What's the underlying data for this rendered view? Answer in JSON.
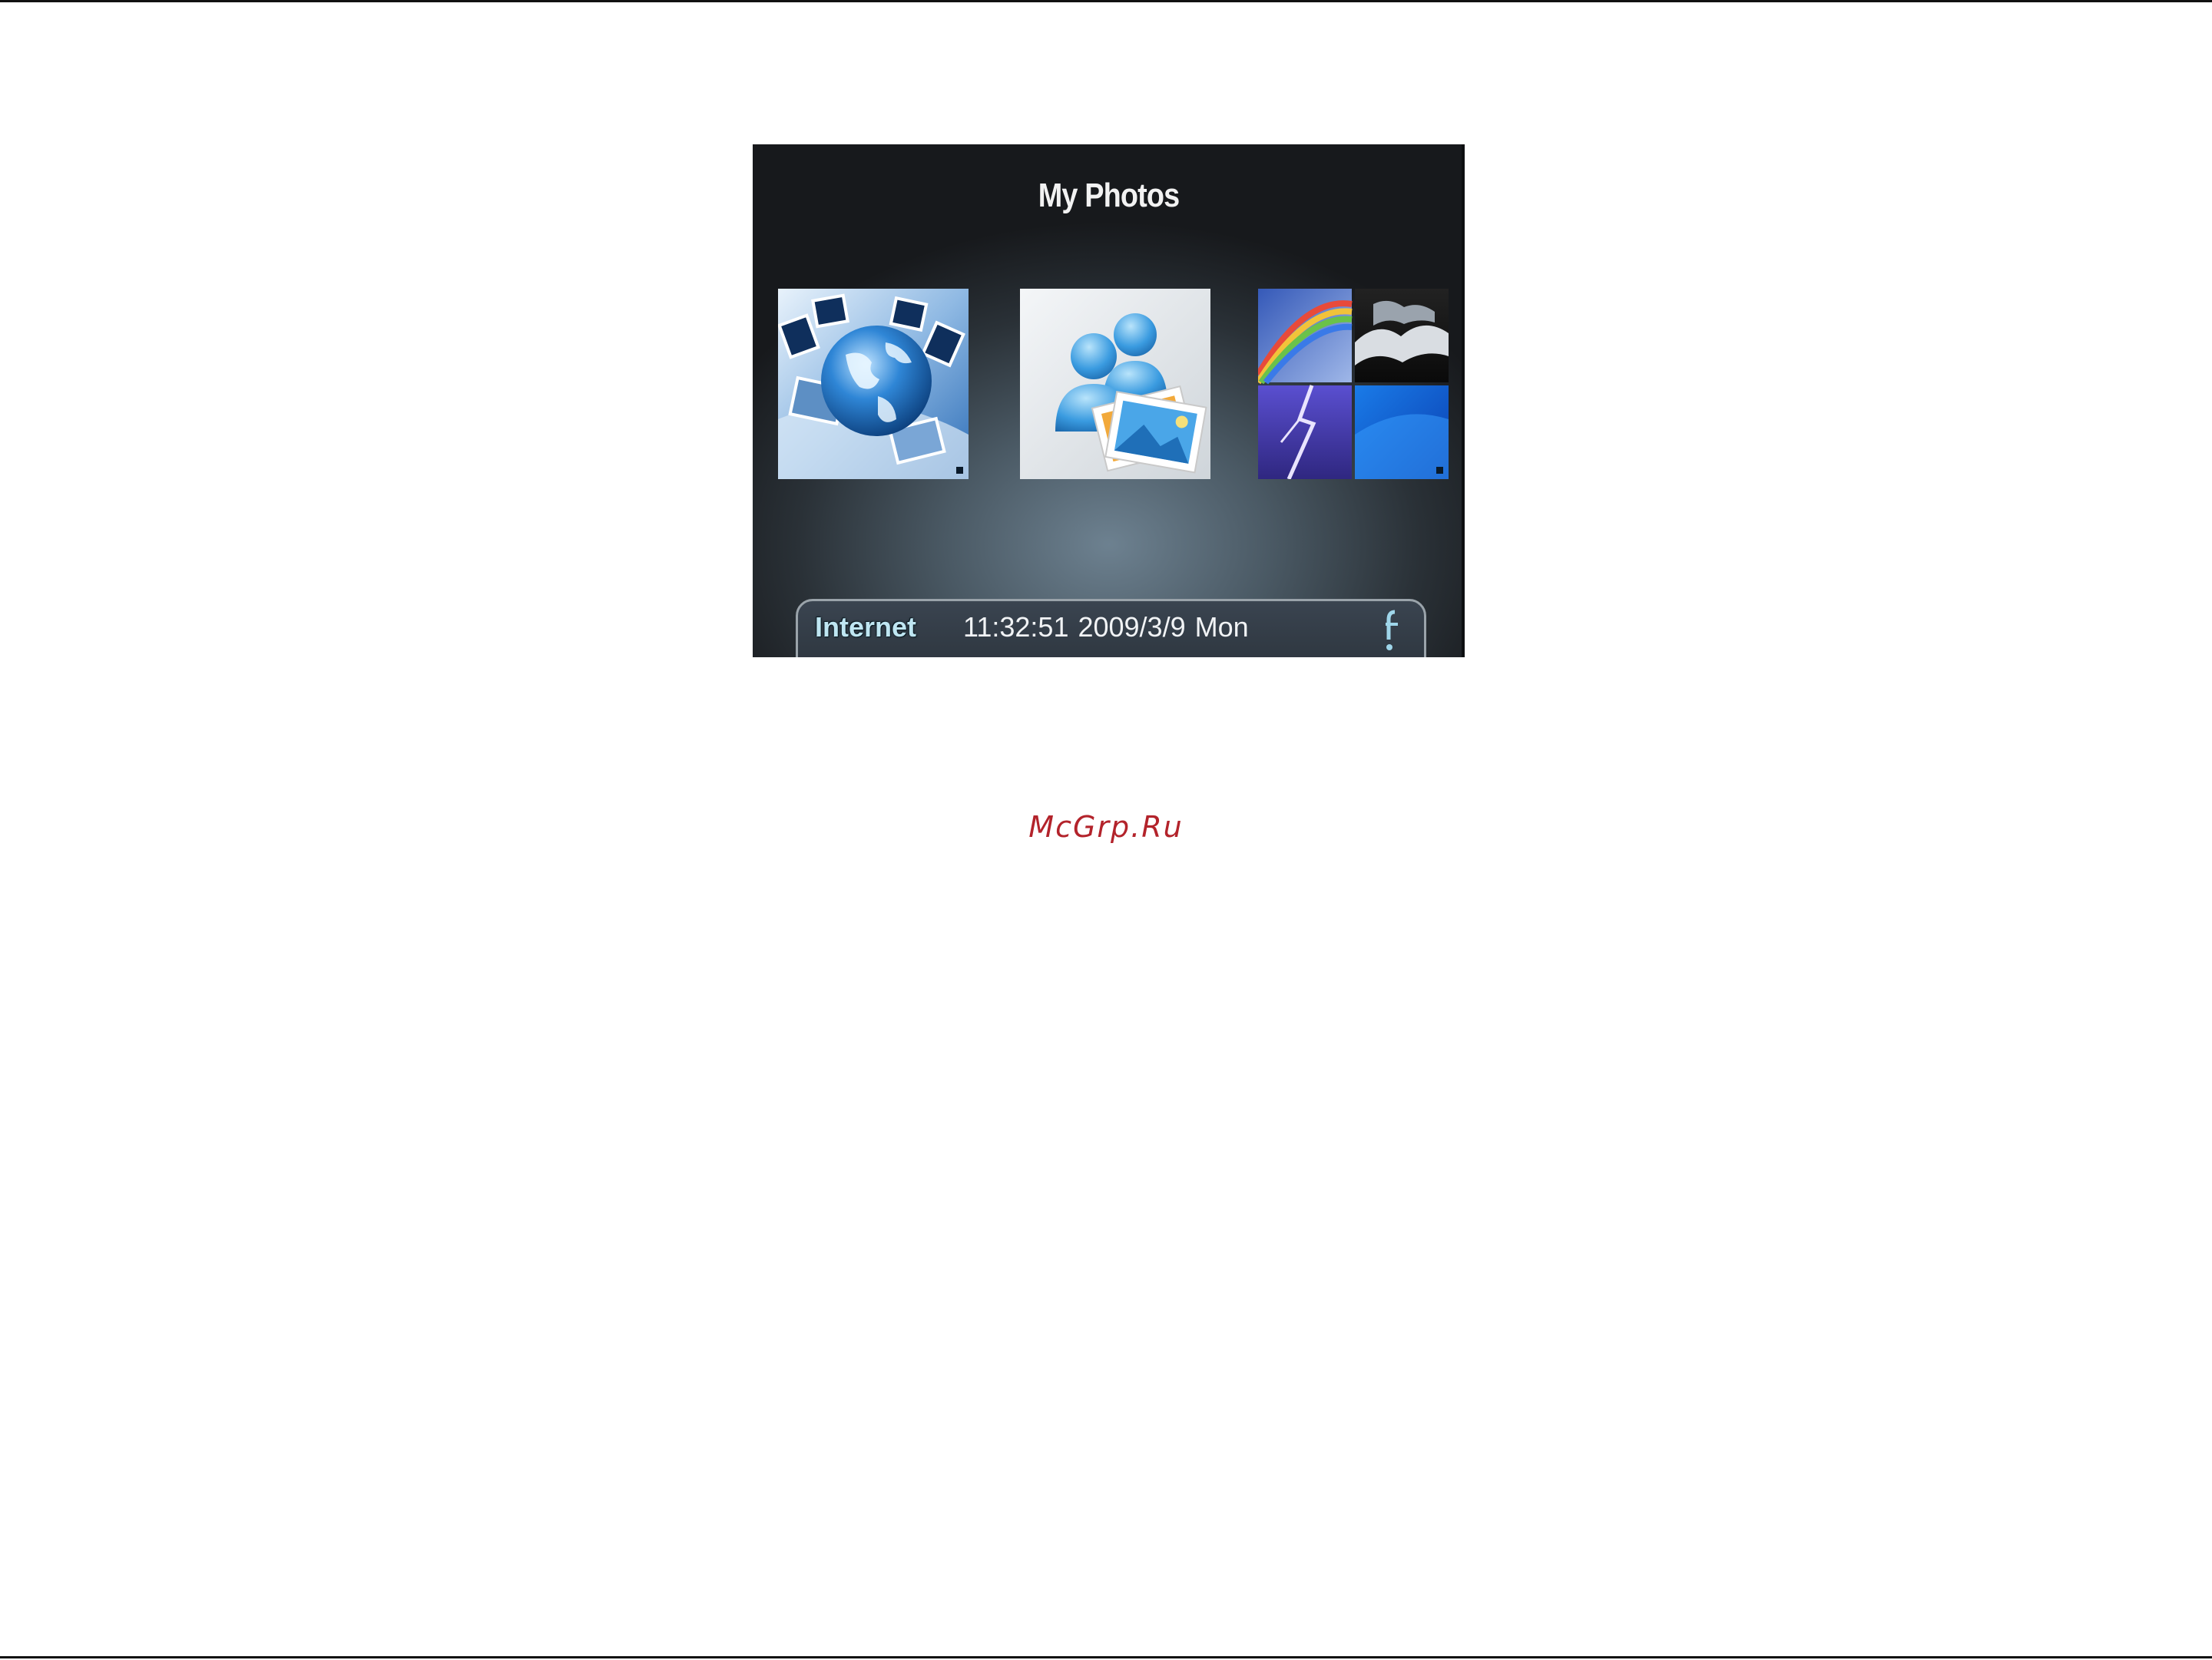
{
  "screen": {
    "title": "My Photos",
    "tiles": [
      {
        "name": "internet-photos",
        "icon": "globe-photos-icon"
      },
      {
        "name": "friends-photos",
        "icon": "people-photos-icon"
      },
      {
        "name": "local-photos",
        "icon": "photo-collage-icon"
      }
    ],
    "status": {
      "connection": "Internet",
      "datetime": "11:32:51 2009/3/9  Mon",
      "info_icon": "info-icon"
    }
  },
  "watermark": "McGrp.Ru",
  "colors": {
    "accent": "#bfe6f2",
    "watermark": "#b3232b",
    "screen_dark": "#17191c"
  }
}
